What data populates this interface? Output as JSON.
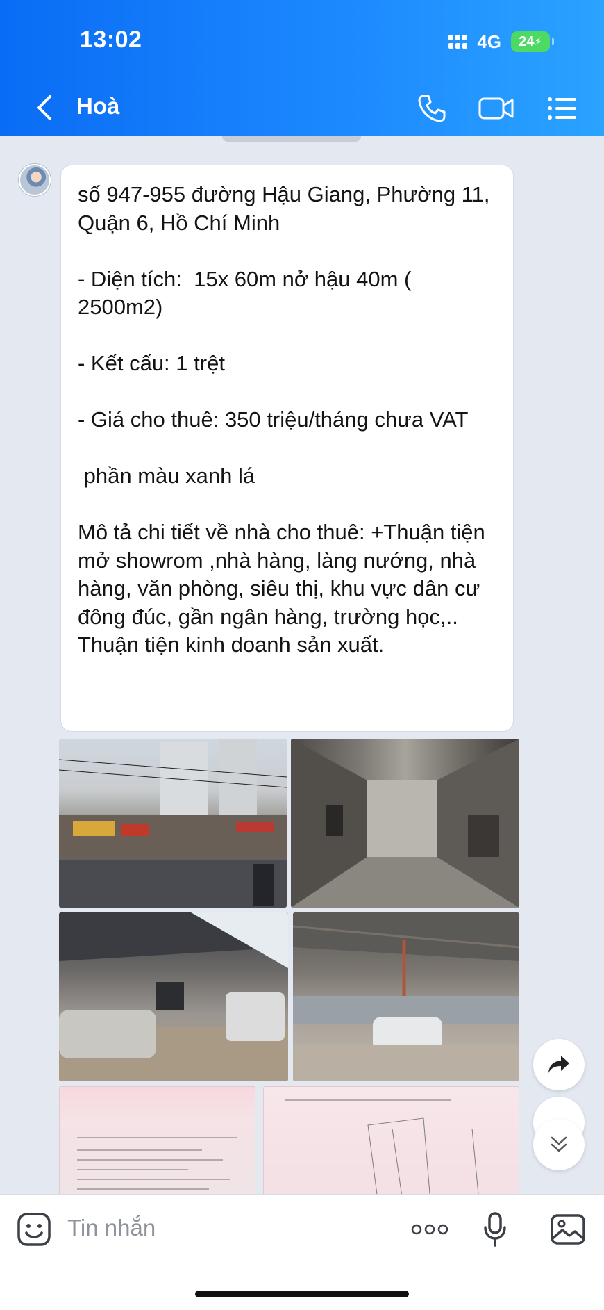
{
  "status_bar": {
    "time": "13:02",
    "network": "4G",
    "battery": "24"
  },
  "header": {
    "title": "Hoà"
  },
  "message": {
    "lines": [
      "số 947-955 đường Hậu Giang, Phường 11, Quận 6, Hồ Chí Minh",
      "",
      "- Diện tích:  15x 60m nở hậu 40m ( 2500m2)",
      "",
      "- Kết cấu: 1 trệt",
      "",
      "- Giá cho thuê: 350 triệu/tháng chưa VAT",
      "",
      " phần màu xanh lá",
      "",
      "Mô tả chi tiết về nhà cho thuê: +Thuận tiện mở showrom ,nhà hàng, làng nướng, nhà hàng, văn phòng, siêu thị, khu vực dân cư đông đúc, gần ngân hàng, trường học,.. Thuận tiện kinh doanh sản xuất."
    ]
  },
  "input_bar": {
    "placeholder": "Tin nhắn"
  },
  "colors": {
    "header_start": "#0a6cf5",
    "header_end": "#2aa3ff",
    "chat_bg": "#e3e8f1",
    "battery_green": "#4cd964"
  }
}
